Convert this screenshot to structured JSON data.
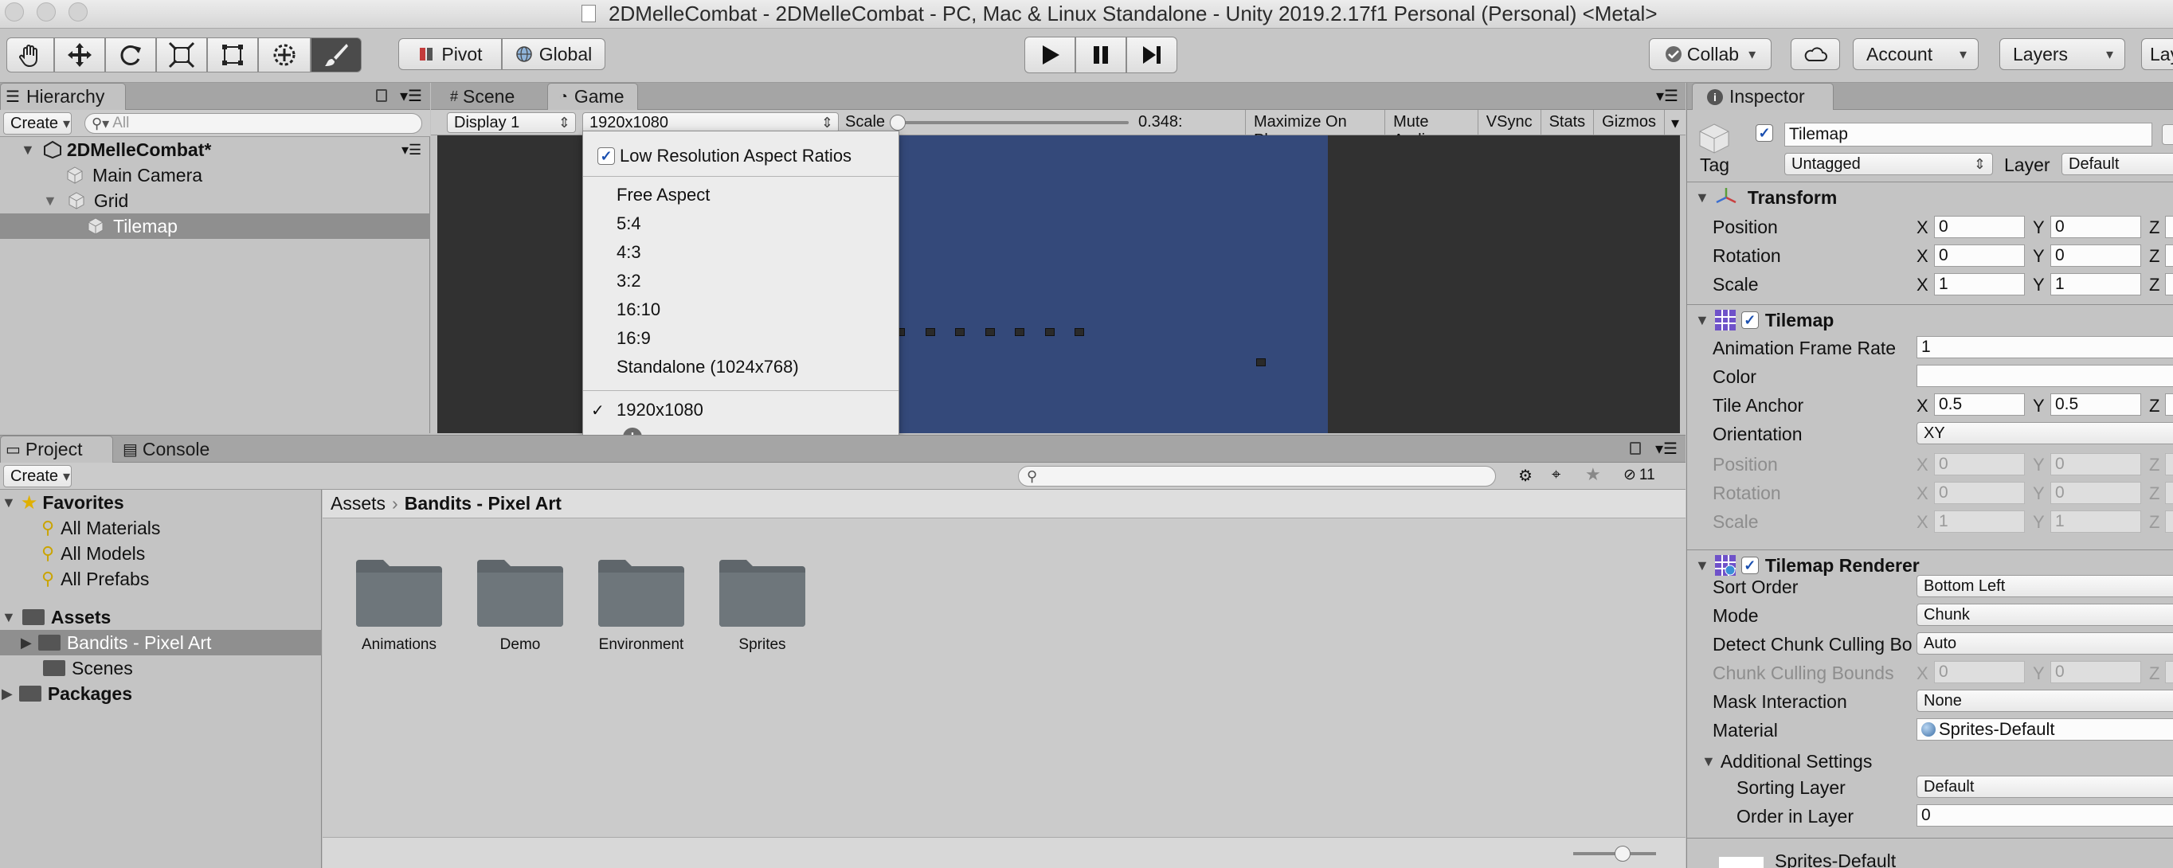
{
  "window": {
    "title": "2DMelleCombat - 2DMelleCombat - PC, Mac & Linux Standalone - Unity 2019.2.17f1 Personal (Personal) <Metal>"
  },
  "toolbar": {
    "pivot": "Pivot",
    "global": "Global",
    "collab": "Collab",
    "account": "Account",
    "layers": "Layers",
    "layout": "Lay"
  },
  "hierarchy": {
    "tab": "Hierarchy",
    "create": "Create",
    "search_placeholder": "All",
    "scene": "2DMelleCombat*",
    "items": [
      "Main Camera",
      "Grid",
      "Tilemap"
    ]
  },
  "center": {
    "tabs": [
      "Scene",
      "Game"
    ],
    "display": "Display 1",
    "resolution": "1920x1080",
    "scale_label": "Scale",
    "scale_value": "0.348:",
    "scale_fraction": 0.0,
    "buttons": [
      "Maximize On Play",
      "Mute Audio",
      "VSync",
      "Stats",
      "Gizmos"
    ]
  },
  "aspect_menu": {
    "header": "Low Resolution Aspect Ratios",
    "items": [
      "Free Aspect",
      "5:4",
      "4:3",
      "3:2",
      "16:10",
      "16:9",
      "Standalone (1024x768)"
    ],
    "custom": "1920x1080",
    "checkmark": "✓"
  },
  "project": {
    "tabs": [
      "Project",
      "Console"
    ],
    "create": "Create",
    "hidden_count": "11",
    "favorites": {
      "label": "Favorites",
      "items": [
        "All Materials",
        "All Models",
        "All Prefabs"
      ]
    },
    "assets": {
      "label": "Assets",
      "items": [
        "Bandits - Pixel Art",
        "Scenes"
      ]
    },
    "packages": "Packages",
    "breadcrumb": [
      "Assets",
      "Bandits - Pixel Art"
    ],
    "folders": [
      "Animations",
      "Demo",
      "Environment",
      "Sprites"
    ]
  },
  "inspector": {
    "tab": "Inspector",
    "object_name": "Tilemap",
    "tag_label": "Tag",
    "tag": "Untagged",
    "layer_label": "Layer",
    "layer": "Default",
    "transform": {
      "title": "Transform",
      "rows": [
        {
          "label": "Position",
          "x": "0",
          "y": "0"
        },
        {
          "label": "Rotation",
          "x": "0",
          "y": "0"
        },
        {
          "label": "Scale",
          "x": "1",
          "y": "1"
        }
      ]
    },
    "tilemap": {
      "title": "Tilemap",
      "frame_rate_label": "Animation Frame Rate",
      "frame_rate": "1",
      "color_label": "Color",
      "anchor_label": "Tile Anchor",
      "anchor_x": "0.5",
      "anchor_y": "0.5",
      "orientation_label": "Orientation",
      "orientation": "XY",
      "disabled_rows": [
        {
          "label": "Position",
          "x": "0",
          "y": "0"
        },
        {
          "label": "Rotation",
          "x": "0",
          "y": "0"
        },
        {
          "label": "Scale",
          "x": "1",
          "y": "1"
        }
      ]
    },
    "renderer": {
      "title": "Tilemap Renderer",
      "sort_label": "Sort Order",
      "sort": "Bottom Left",
      "mode_label": "Mode",
      "mode": "Chunk",
      "culling_label": "Detect Chunk Culling Bo",
      "culling": "Auto",
      "bounds_label": "Chunk Culling Bounds",
      "bounds_x": "0",
      "bounds_y": "0",
      "mask_label": "Mask Interaction",
      "mask": "None",
      "material_label": "Material",
      "material": "Sprites-Default"
    },
    "additional": {
      "title": "Additional Settings",
      "sorting_layer_label": "Sorting Layer",
      "sorting_layer": "Default",
      "order_label": "Order in Layer",
      "order": "0"
    },
    "material_preview": "Sprites-Default",
    "axis": {
      "x": "X",
      "y": "Y",
      "z": "Z"
    }
  }
}
